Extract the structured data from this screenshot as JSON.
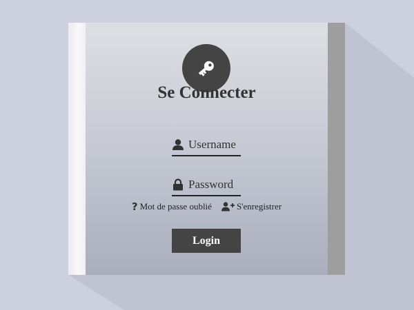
{
  "colors": {
    "background": "#ccd0df",
    "shadow": "#bfc3d2",
    "panel_top": "#dedfe4",
    "panel_bottom": "#a9aebd",
    "edge_right": "#9e9e9e",
    "accent_dark": "#444444",
    "button_text": "#ffffff"
  },
  "header": {
    "icon": "key-icon",
    "title": "Se Connecter"
  },
  "form": {
    "username": {
      "icon": "user-icon",
      "placeholder": "Username",
      "value": ""
    },
    "password": {
      "icon": "lock-icon",
      "placeholder": "Password",
      "value": ""
    }
  },
  "links": {
    "forgot": {
      "icon": "question-icon",
      "label": "Mot de passe oublié"
    },
    "register": {
      "icon": "user-plus-icon",
      "label": "S'enregistrer"
    }
  },
  "login_button": {
    "label": "Login"
  }
}
